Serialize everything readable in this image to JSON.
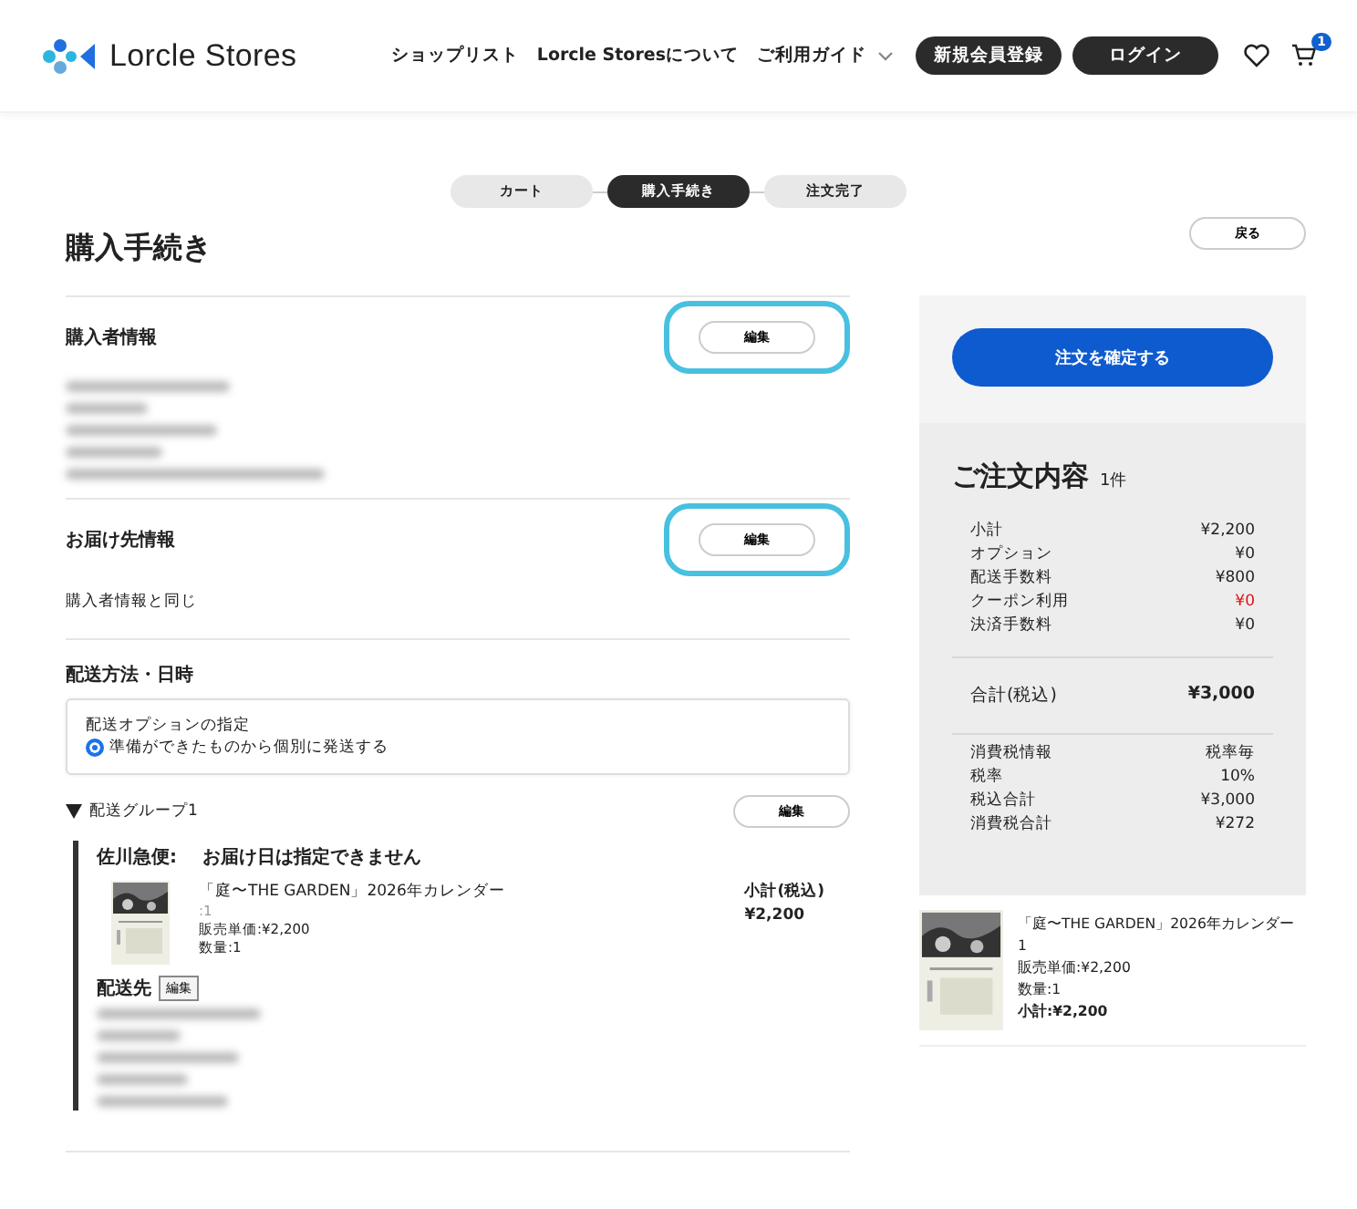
{
  "header": {
    "logo": "Lorcle Stores",
    "nav": [
      "ショップリスト",
      "Lorcle Storesについて",
      "ご利用ガイド"
    ],
    "buttons": [
      "新規会員登録",
      "ログイン"
    ],
    "cart_count": "1"
  },
  "steps": [
    {
      "label": "カート",
      "selected": false
    },
    {
      "label": "購入手続き",
      "selected": true
    },
    {
      "label": "注文完了",
      "selected": false
    }
  ],
  "page_title": "購入手続き",
  "back_button": "戻る",
  "buyer": {
    "title": "購入者情報",
    "edit": "編集",
    "highlighted": true
  },
  "delivery": {
    "title": "お届け先情報",
    "edit": "編集",
    "highlighted": true,
    "text": "購入者情報と同じ"
  },
  "shipping": {
    "title": "配送方法・日時",
    "option_label": "配送オプションの指定",
    "options": [
      {
        "label": "準備ができたものから個別に発送する",
        "selected": true
      }
    ],
    "group": {
      "title": "配送グループ1",
      "expanded": true,
      "edit": "編集",
      "carrier": "佐川急便:",
      "date_note": "お届け日は指定できません",
      "item": {
        "name": "「庭〜THE GARDEN」2026年カレンダー",
        "variant": ":1",
        "unit_price": "販売単価:¥2,200",
        "quantity": "数量:1",
        "subtotal_label": "小計(税込)",
        "subtotal": "¥2,200"
      },
      "destination_label": "配送先",
      "destination_edit": "編集"
    }
  },
  "summary": {
    "confirm_button": "注文を確定する",
    "title": "ご注文内容",
    "count": "1件",
    "lines": [
      {
        "label": "小計",
        "value": "¥2,200",
        "highlight": false
      },
      {
        "label": "オプション",
        "value": "¥0",
        "highlight": false
      },
      {
        "label": "配送手数料",
        "value": "¥800",
        "highlight": false
      },
      {
        "label": "クーポン利用",
        "value": "¥0",
        "highlight": true
      },
      {
        "label": "決済手数料",
        "value": "¥0",
        "highlight": false
      }
    ],
    "total_label": "合計(税込)",
    "total": "¥3,000",
    "tax_lines": [
      {
        "label": "消費税情報",
        "value": "税率毎"
      },
      {
        "label": "税率",
        "value": "10%"
      },
      {
        "label": "税込合計",
        "value": "¥3,000"
      },
      {
        "label": "消費税合計",
        "value": "¥272"
      }
    ],
    "item": {
      "name": "「庭〜THE GARDEN」2026年カレンダー",
      "variant": "1",
      "unit_price": "販売単価:¥2,200",
      "quantity": "数量:1",
      "subtotal": "小計:¥2,200"
    }
  }
}
